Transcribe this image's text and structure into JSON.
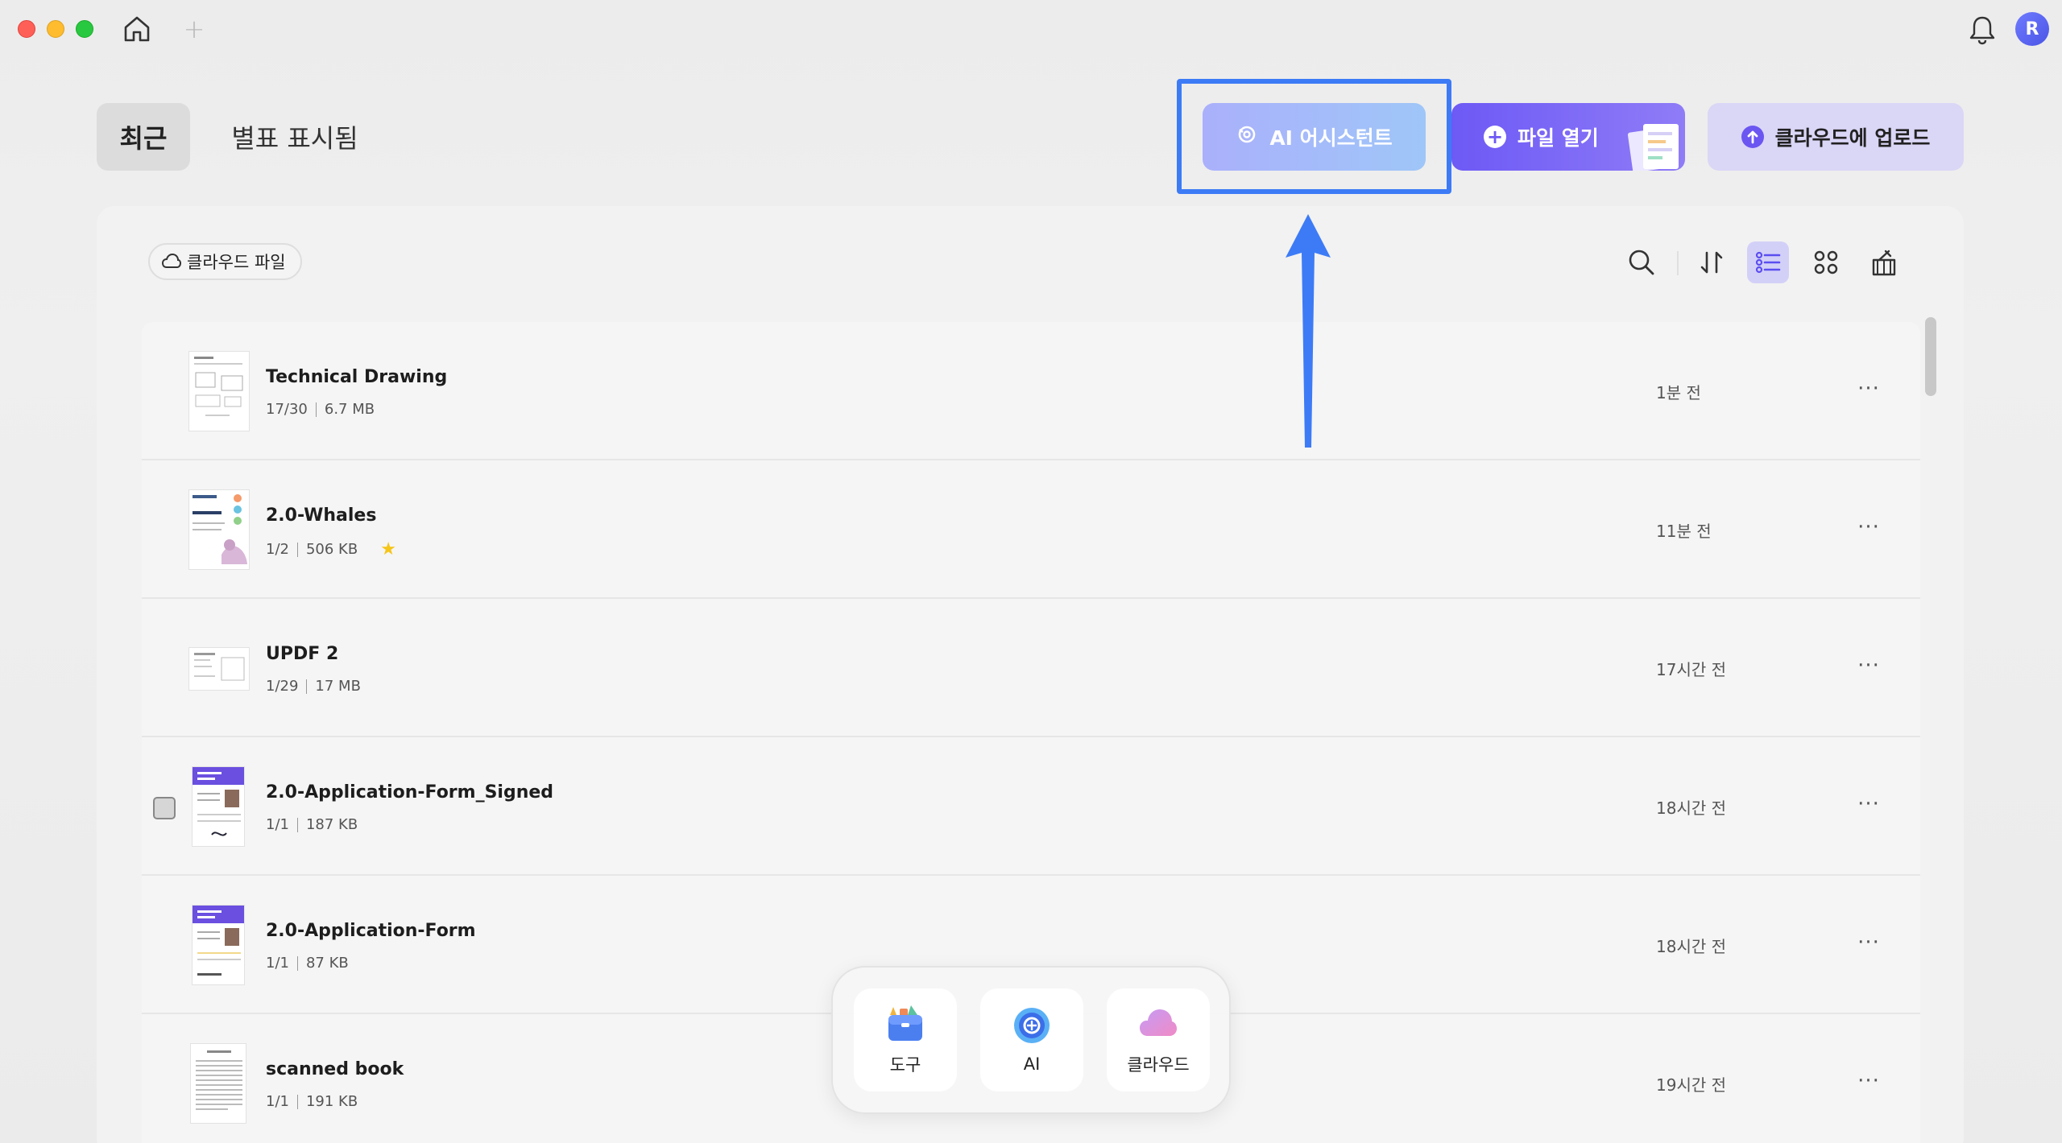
{
  "titlebar": {
    "new_tab_symbol": "+",
    "avatar_initial": "R"
  },
  "tabs": {
    "recent": "최근",
    "starred": "별표 표시됨"
  },
  "actions": {
    "ai_assistant": "AI 어시스턴트",
    "open_file": "파일 열기",
    "open_file_symbol": "+",
    "upload_cloud": "클라우드에 업로드"
  },
  "panel": {
    "cloud_files": "클라우드 파일"
  },
  "files": [
    {
      "name": "Technical Drawing",
      "pages": "17/30",
      "size": "6.7 MB",
      "time": "1분 전",
      "starred": false
    },
    {
      "name": "2.0-Whales",
      "pages": "1/2",
      "size": "506 KB",
      "time": "11분 전",
      "starred": true
    },
    {
      "name": "UPDF 2",
      "pages": "1/29",
      "size": "17 MB",
      "time": "17시간 전",
      "starred": false
    },
    {
      "name": "2.0-Application-Form_Signed",
      "pages": "1/1",
      "size": "187 KB",
      "time": "18시간 전",
      "starred": false
    },
    {
      "name": "2.0-Application-Form",
      "pages": "1/1",
      "size": "87 KB",
      "time": "18시간 전",
      "starred": false
    },
    {
      "name": "scanned book",
      "pages": "1/1",
      "size": "191 KB",
      "time": "19시간 전",
      "starred": false
    }
  ],
  "more_symbol": "···",
  "star_symbol": "★",
  "dock": {
    "tools": "도구",
    "ai": "AI",
    "cloud": "클라우드"
  },
  "colors": {
    "accent_purple": "#6d59f5",
    "highlight_blue": "#3d7bf6",
    "star": "#f5c518"
  }
}
